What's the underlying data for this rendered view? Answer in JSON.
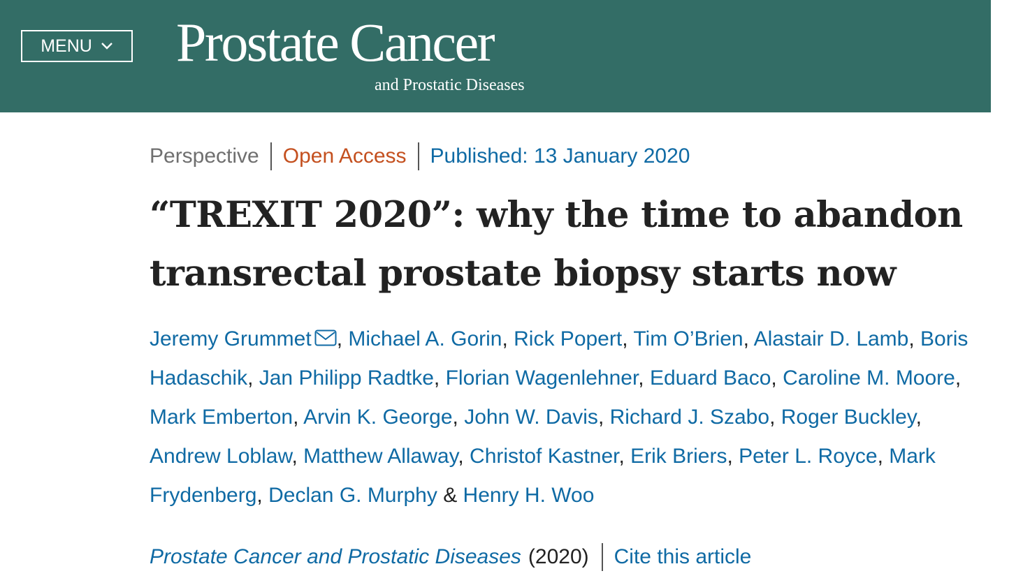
{
  "header": {
    "menu_label": "MENU",
    "logo_title": "Prostate Cancer",
    "logo_subtitle": "and Prostatic Diseases",
    "background_color": "#336d66"
  },
  "article": {
    "type": "Perspective",
    "access": "Open Access",
    "published": "Published: 13 January 2020",
    "title": "“TREXIT 2020”: why the time to abandon transrectal prostate biopsy starts now",
    "authors": [
      "Jeremy Grummet",
      "Michael A. Gorin",
      "Rick Popert",
      "Tim O’Brien",
      "Alastair D. Lamb",
      "Boris Hadaschik",
      "Jan Philipp Radtke",
      "Florian Wagenlehner",
      "Eduard Baco",
      "Caroline M. Moore",
      "Mark Emberton",
      "Arvin K. George",
      "John W. Davis",
      "Richard J. Szabo",
      "Roger Buckley",
      "Andrew Loblaw",
      "Matthew Allaway",
      "Christof Kastner",
      "Erik Briers",
      "Peter L. Royce",
      "Mark Frydenberg",
      "Declan G. Murphy",
      "Henry H. Woo"
    ],
    "journal": "Prostate Cancer and Prostatic Diseases",
    "year": "(2020)",
    "cite_label": "Cite this article"
  },
  "icons": {
    "menu": "chevron-down-icon",
    "corresponding_author": "mail-icon"
  }
}
